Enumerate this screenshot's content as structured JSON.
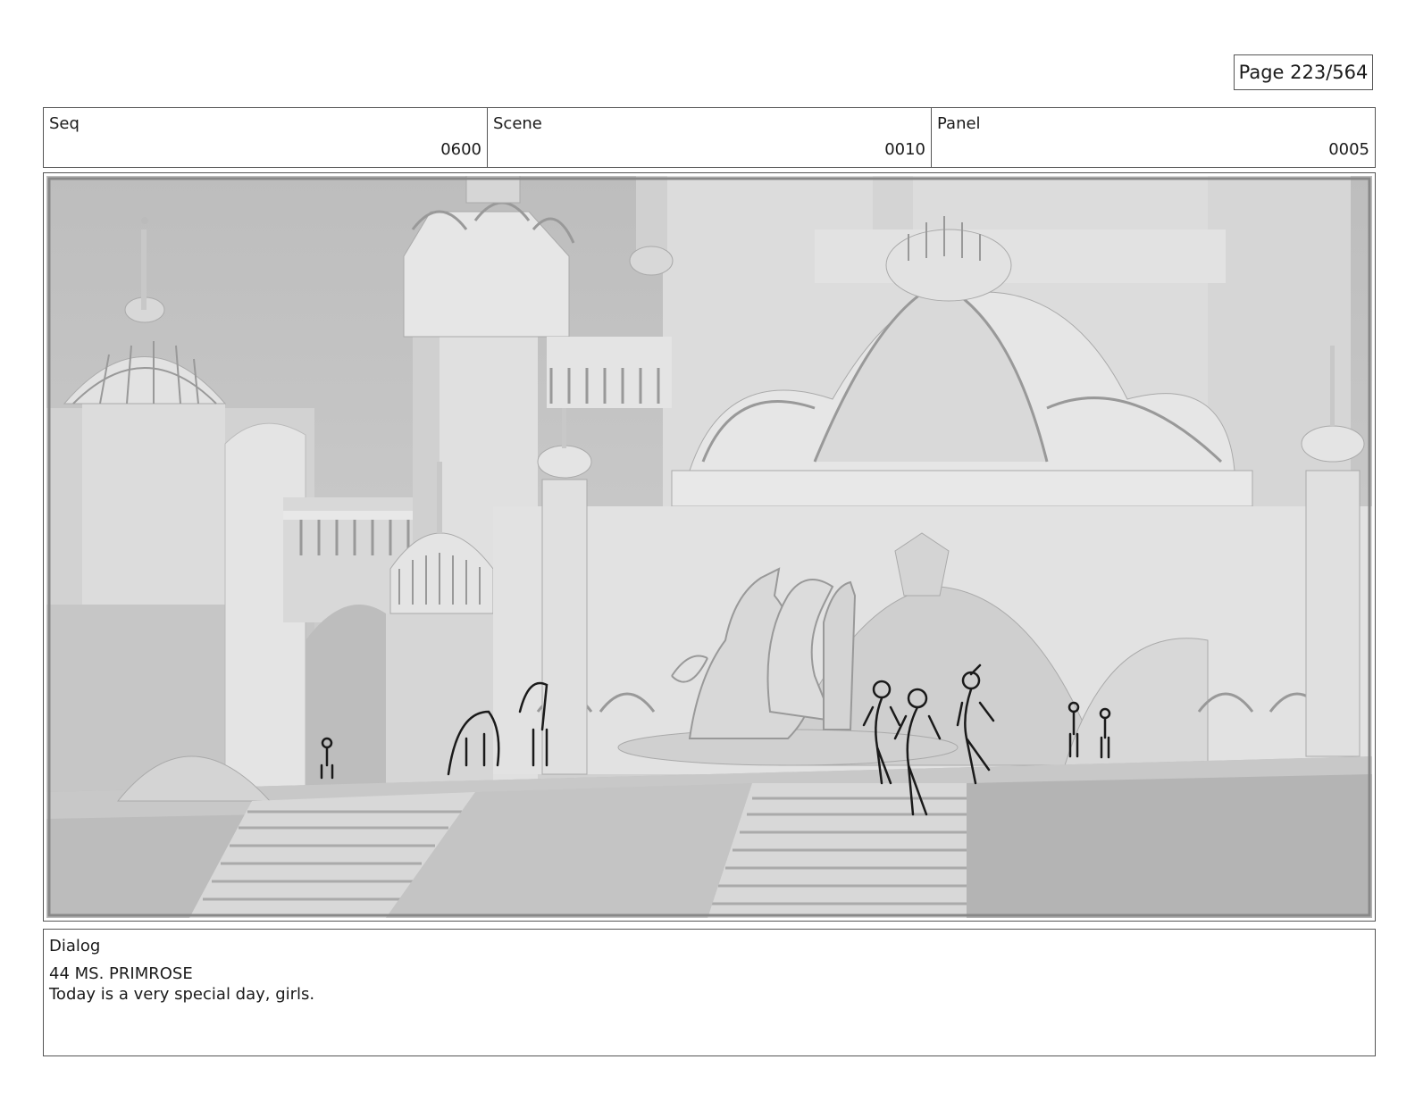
{
  "page": {
    "label": "Page 223/564"
  },
  "header": {
    "seq": {
      "label": "Seq",
      "value": "0600"
    },
    "scene": {
      "label": "Scene",
      "value": "0010"
    },
    "panel": {
      "label": "Panel",
      "value": "0005"
    }
  },
  "dialog": {
    "label": "Dialog",
    "speaker": "44 MS. PRIMROSE",
    "line": "Today is a very special day, girls."
  },
  "colors": {
    "border": "#555555",
    "sky": "#c4c4c4",
    "building": "#dedede",
    "shadow": "#b0b0b0",
    "ink": "#1a1a1a"
  }
}
